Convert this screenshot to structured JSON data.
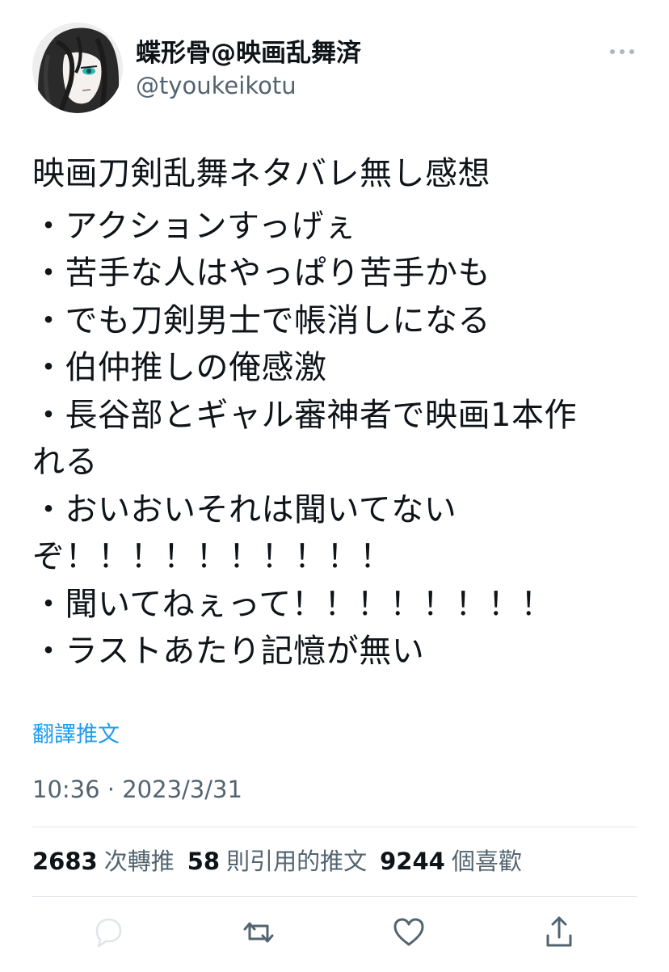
{
  "user": {
    "display_name": "蝶形骨@映画乱舞済",
    "handle": "@tyoukeikotu",
    "avatar": "anime-character-avatar"
  },
  "tweet": {
    "lines": [
      "映画刀剣乱舞ネタバレ無し感想",
      "・アクションすっげぇ",
      "・苦手な人はやっぱり苦手かも",
      "・でも刀剣男士で帳消しになる",
      "・伯仲推しの俺感激",
      "・長谷部とギャル審神者で映画1本作",
      "れる",
      "・おいおいそれは聞いてない",
      "ぞ！！！！！！！！！！",
      "・聞いてねぇって！！！！！！！！",
      "・ラストあたり記憶が無い"
    ],
    "translate_label": "翻譯推文",
    "timestamp": "10:36 · 2023/3/31"
  },
  "stats": {
    "retweets_count": "2683",
    "retweets_label": "次轉推",
    "quotes_count": "58",
    "quotes_label": "則引用的推文",
    "likes_count": "9244",
    "likes_label": "個喜歡"
  },
  "icons": {
    "more": "more-horizontal-icon",
    "reply": "reply-icon",
    "retweet": "retweet-icon",
    "like": "heart-icon",
    "share": "share-icon"
  },
  "colors": {
    "link": "#1d9bf0",
    "secondary_text": "#536471",
    "primary_text": "#0f1419",
    "divider": "#e1e8ed"
  }
}
